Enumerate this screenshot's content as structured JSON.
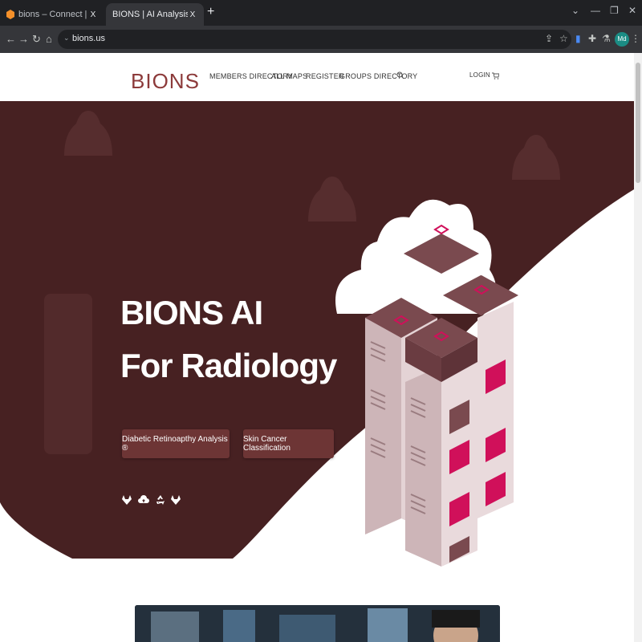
{
  "browser": {
    "tabs": [
      {
        "title": "bions – Connect | Lightsail",
        "close": "X"
      },
      {
        "title": "BIONS | AI Analysis Tools for Rad",
        "close": "X"
      }
    ],
    "new_tab": "+",
    "url": "bions.us",
    "profile_initials": "Md"
  },
  "site": {
    "logo": "BIONS",
    "menu": [
      "MEMBERS DIRECTORY",
      "ALL MAPS",
      "REGISTER",
      "GROUPS DIRECTORY"
    ],
    "login": "LOGIN"
  },
  "hero": {
    "title_line1": "BIONS AI",
    "title_line2": "For Radiology",
    "buttons": [
      "Diabetic Retinoapthy Analysis ®",
      "Skin Cancer Classification"
    ],
    "social_icons": [
      "gitlab-icon",
      "upload-cloud-icon",
      "recycle-icon",
      "gitlab-icon"
    ]
  },
  "colors": {
    "hero_bg": "#472122",
    "button_bg": "#6d3535",
    "logo": "#8c3a3a",
    "server_top": "#7a4a4f",
    "server_side": "#d8c3c5",
    "server_accent": "#d0105a"
  }
}
